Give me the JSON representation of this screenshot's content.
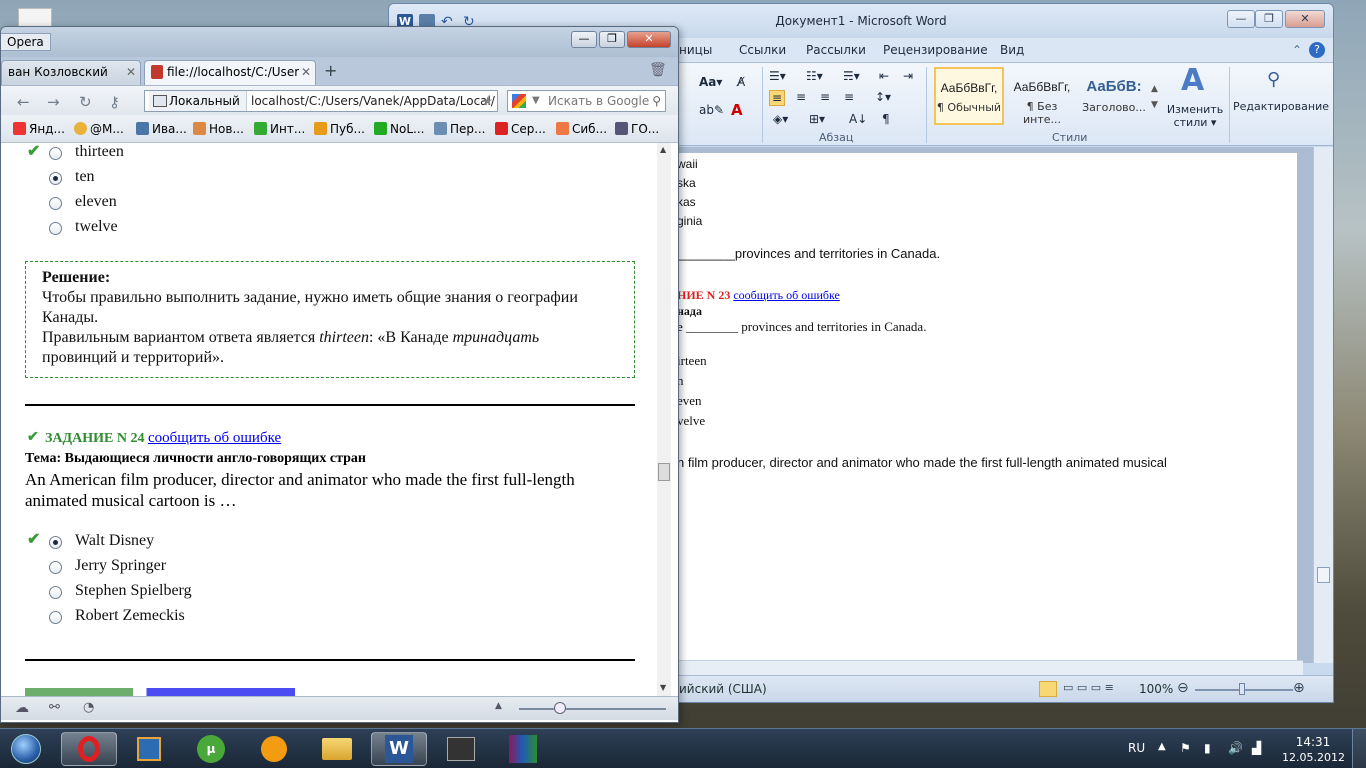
{
  "word": {
    "title": "Документ1  -  Microsoft Word",
    "tabs": [
      "ницы",
      "Ссылки",
      "Рассылки",
      "Рецензирование",
      "Вид"
    ],
    "font_size_btn": "Aa▾",
    "paragraph_group": "Абзац",
    "styles_group": "Стили",
    "styles": [
      {
        "sample": "АаБбВвГг,",
        "name": "¶ Обычный"
      },
      {
        "sample": "АаБбВвГг,",
        "name": "¶ Без инте..."
      },
      {
        "sample": "АаБбВ:",
        "name": "Заголово..."
      }
    ],
    "change_styles": "Изменить стили ▾",
    "editing": "Редактирование",
    "doc_lines": {
      "l1": "waii",
      "l2": "ska",
      "l3": "kas",
      "l4": "ginia",
      "l5": "________provinces and territories in Canada.",
      "task23_head": "НИЕ N 23",
      "task23_link": "сообщить об ошибке",
      "topic": "нада",
      "l6": "e ________ provinces and territories in Canada.",
      "o1": "irteen",
      "o2": "n",
      "o3": "even",
      "o4": "velve",
      "l7": "n film producer, director and animator who made the first full-length animated musical"
    },
    "status_lang": "ийский (США)",
    "zoom": "100%"
  },
  "opera": {
    "logo": "Opera",
    "tabs": [
      "ван Козловский",
      "file://localhost/C:/User..."
    ],
    "address_label": "Локальный",
    "url": "localhost/C:/Users/Vanek/AppData/Local/",
    "search_placeholder": "Искать в Google",
    "bookmarks": [
      "Янд...",
      "@M...",
      "Ива...",
      "Нов...",
      "Инт...",
      "Пуб...",
      "NoL...",
      "Пер...",
      "Сер...",
      "Сиб...",
      "ГО..."
    ],
    "task23_options": [
      "thirteen",
      "ten",
      "eleven",
      "twelve"
    ],
    "solution": {
      "title": "Решение:",
      "p1": "Чтобы правильно выполнить задание, нужно иметь общие знания о географии Канады.",
      "p2_pre": "Правильным вариантом ответа является ",
      "p2_answer": "thirteen",
      "p2_mid": ": «В Канаде ",
      "p2_word": "тринадцать",
      "p2_post": " провинций и территорий»."
    },
    "task24": {
      "head": "ЗАДАНИЕ N 24",
      "report_link": "сообщить об ошибке",
      "topic": "Тема: Выдающиеся личности англо-говорящих стран",
      "question": "An American film producer, director and animator who made the first full-length animated musical cartoon is …",
      "options": [
        "Walt Disney",
        "Jerry Springer",
        "Stephen Spielberg",
        "Robert Zemeckis"
      ]
    }
  },
  "taskbar": {
    "lang": "RU",
    "time": "14:31",
    "date": "12.05.2012"
  },
  "colors": {
    "green": "#2e8b2e",
    "link": "#0000ee",
    "taskbar": "#1f2d3d"
  }
}
